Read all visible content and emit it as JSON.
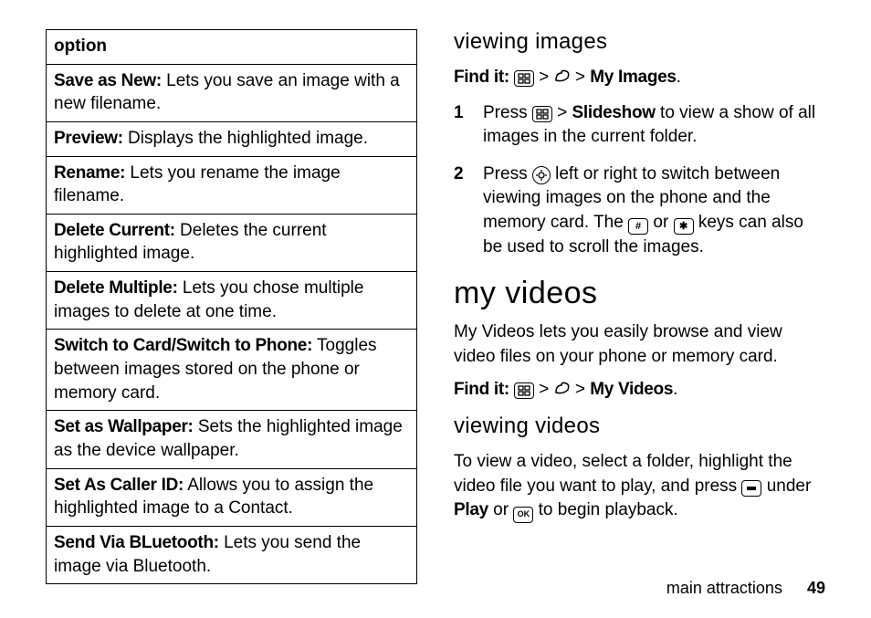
{
  "options_table": {
    "header": "option",
    "rows": [
      {
        "term": "Save as New:",
        "desc": " Lets you save an image with a new filename."
      },
      {
        "term": "Preview:",
        "desc": " Displays the highlighted image."
      },
      {
        "term": "Rename:",
        "desc": " Lets you rename the image filename."
      },
      {
        "term": "Delete Current:",
        "desc": " Deletes the current highlighted image."
      },
      {
        "term": "Delete Multiple:",
        "desc": " Lets you chose multiple images to delete at one time."
      },
      {
        "term": "Switch to Card/Switch to Phone:",
        "desc": " Toggles between images stored on the phone or memory card."
      },
      {
        "term": "Set as Wallpaper:",
        "desc": " Sets the highlighted image as the device wallpaper."
      },
      {
        "term": "Set As Caller ID:",
        "desc": " Allows you to assign the highlighted image to a Contact."
      },
      {
        "term": "Send Via BLuetooth:",
        "desc": " Lets you send the image via Bluetooth."
      }
    ]
  },
  "right": {
    "viewing_images_heading": "viewing images",
    "find_it_label": "Find it: ",
    "gt": " > ",
    "my_images": "My Images",
    "period": ".",
    "step1_a": "Press ",
    "step1_b": " > ",
    "step1_slideshow": "Slideshow",
    "step1_c": " to view a show of all images in the current folder.",
    "step2_a": "Press ",
    "step2_b": " left or right to switch between viewing images on the phone and the memory card. The ",
    "step2_c": " or ",
    "step2_d": " keys can also be used to scroll the images.",
    "hash": "#",
    "star": "✱",
    "my_videos_heading": "my videos",
    "my_videos_intro": "My Videos lets you easily browse and view video files on your phone or memory card.",
    "my_videos_path": "My Videos",
    "viewing_videos_heading": "viewing videos",
    "viewing_videos_a": "To view a video, select a folder, highlight the video file you want to play, and press ",
    "viewing_videos_b": " under ",
    "viewing_videos_play": "Play",
    "viewing_videos_c": " or ",
    "viewing_videos_d": " to begin playback.",
    "ok_label": "OK"
  },
  "footer": {
    "section": "main attractions",
    "page": "49"
  }
}
